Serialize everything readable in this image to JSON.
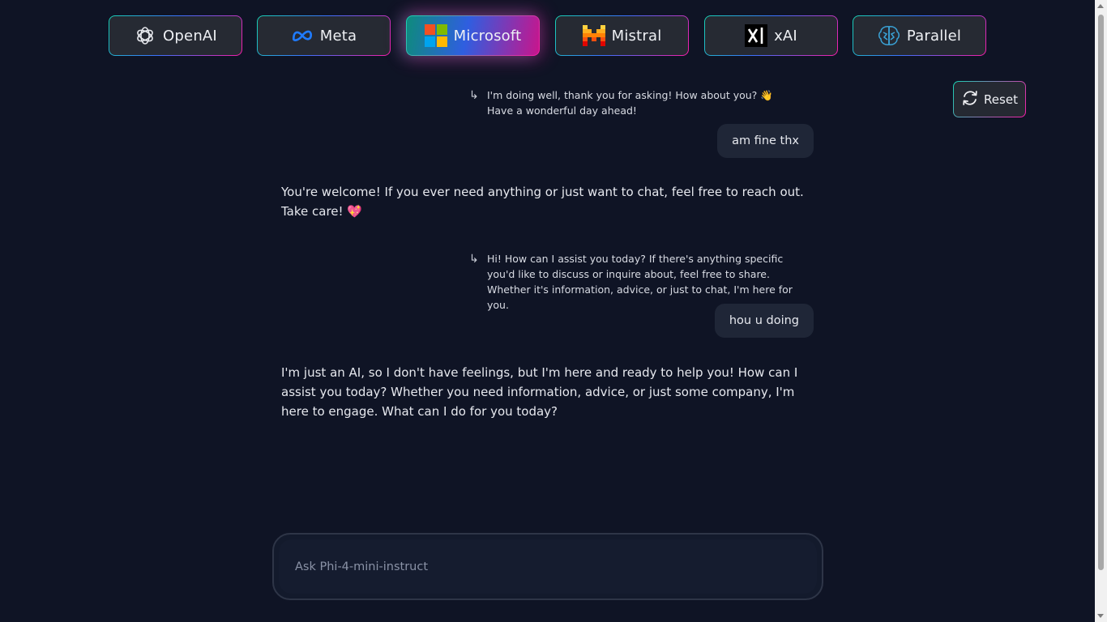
{
  "providers": [
    {
      "label": "OpenAI",
      "icon": "openai-icon",
      "active": false
    },
    {
      "label": "Meta",
      "icon": "meta-icon",
      "active": false
    },
    {
      "label": "Microsoft",
      "icon": "microsoft-icon",
      "active": true
    },
    {
      "label": "Mistral",
      "icon": "mistral-icon",
      "active": false
    },
    {
      "label": "xAI",
      "icon": "xai-icon",
      "active": false
    },
    {
      "label": "Parallel",
      "icon": "parallel-brain-icon",
      "active": false
    }
  ],
  "reset": {
    "label": "Reset",
    "icon": "refresh-icon"
  },
  "chat": {
    "messages": [
      {
        "type": "quote",
        "text": "I'm doing well, thank you for asking! How about you? 👋 Have a wonderful day ahead!"
      },
      {
        "type": "user",
        "text": "am fine thx"
      },
      {
        "type": "assistant",
        "text": "You're welcome! If you ever need anything or just want to chat, feel free to reach out. Take care! 💖"
      },
      {
        "type": "quote",
        "text": "Hi! How can I assist you today? If there's anything specific you'd like to discuss or inquire about, feel free to share. Whether it's information, advice, or just to chat, I'm here for you."
      },
      {
        "type": "user",
        "text": "hou u doing"
      },
      {
        "type": "assistant",
        "text": "I'm just an AI, so I don't have feelings, but I'm here and ready to help you! How can I assist you today? Whether you need information, advice, or just some company, I'm here to engage. What can I do for you today?"
      }
    ]
  },
  "input": {
    "placeholder": "Ask Phi-4-mini-instruct",
    "value": ""
  },
  "colors": {
    "background": "#0f1425",
    "accent_teal": "#17d3b4",
    "accent_pink": "#f81ca8",
    "bubble": "#1f2637"
  }
}
